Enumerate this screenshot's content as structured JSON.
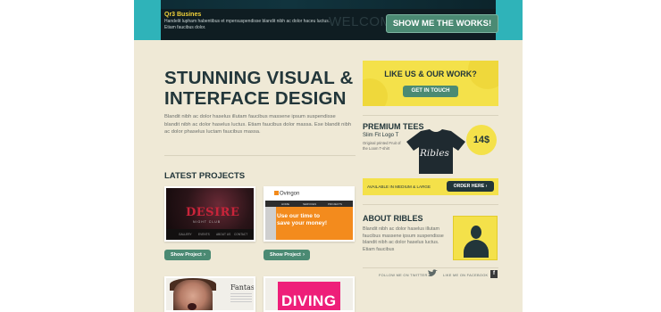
{
  "banner": {
    "title": "Qr3 Busines",
    "text": "Handelit lupham habentibus et mpersuspendisse blandit nibh ac dolor haceu luctus. Etiam faucibus dolor.",
    "welcome": "WELCOM",
    "button": "SHOW ME THE WORKS!"
  },
  "hero": {
    "headline_line1": "STUNNING VISUAL &",
    "headline_line2": "INTERFACE DESIGN",
    "intro": "Blandit nibh ac dolor haselus illutam faucibus massene ipsum suspendisse blandit nibh ac dolor haselus luctus. Etiam faucibus dolor massa. Ese blandit nibh ac dolor phaselus luctam faucibus massa."
  },
  "projects": {
    "heading": "LATEST PROJECTS",
    "show_label": "Show Project",
    "arrow": "›",
    "p1": {
      "title": "DESIRE",
      "sub": "NIGHT CLUB",
      "nav": [
        "GALLERY",
        "EVENTS",
        "ABOUT US",
        "CONTACT"
      ]
    },
    "p2": {
      "logo": "Ovingon",
      "nav": [
        "HOME",
        "SERVICES",
        "PROJECTS"
      ],
      "text": "Use our time to save your money!"
    },
    "p3": {
      "text": "Fantast"
    },
    "p4": {
      "text": "DIVING"
    }
  },
  "like": {
    "title": "LIKE US & OUR WORK?",
    "button": "GET IN TOUCH"
  },
  "tees": {
    "title": "PREMIUM TEES",
    "sub": "Slim Fit Logo T",
    "small": "Original printed Fruit of the Loom T-shirt",
    "shirt_label": "Ribles",
    "price": "14$",
    "bar_text": "AVAILABLE IN MEDIUM & LARGE",
    "order": "ORDER HERE"
  },
  "about": {
    "title": "ABOUT RIBLES",
    "text": "Blandit nibh ac dolor haselus illutam faucibus massene ipsum suspendisse blandit nibh ac dolor haselus luctus. Etiam faucibus"
  },
  "social": {
    "twitter": "FOLLOW ME ON TWITTER",
    "facebook": "LIKE ME ON FACEBOOK",
    "fb_glyph": "f"
  },
  "colors": {
    "accent_green": "#4b8a73",
    "accent_yellow": "#f4e14a",
    "dark_navy": "#22363a",
    "background": "#efe9d6"
  }
}
